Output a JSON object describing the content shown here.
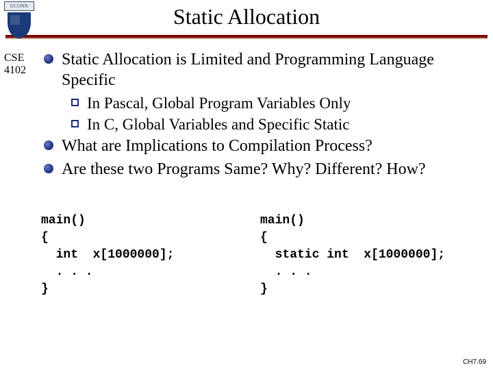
{
  "logo": {
    "top_text": "UCONN"
  },
  "course": {
    "line1": "CSE",
    "line2": "4102"
  },
  "title": "Static Allocation",
  "bullets": {
    "b1": "Static Allocation is Limited and Programming Language Specific",
    "b1a": "In Pascal, Global Program Variables Only",
    "b1b": "In C, Global Variables and Specific Static",
    "b2": "What are Implications to Compilation Process?",
    "b3": "Are these two Programs Same?  Why?  Different?  How?"
  },
  "code": {
    "left": "main()\n{\n  int  x[1000000];\n  . . .\n}",
    "right": "main()\n{\n  static int  x[1000000];\n  . . .\n}"
  },
  "footer": "CH7.69"
}
